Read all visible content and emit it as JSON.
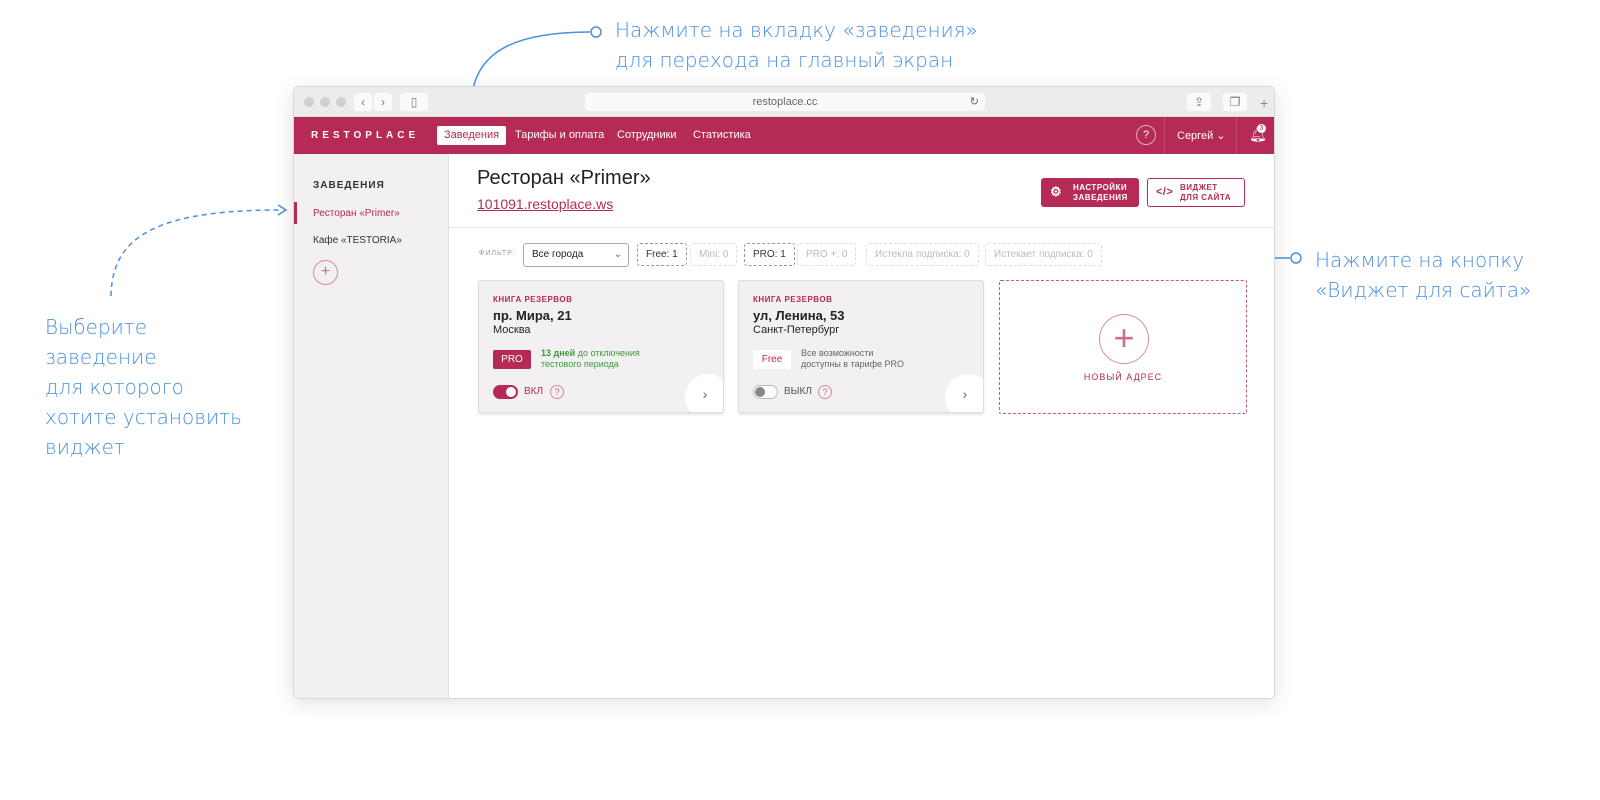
{
  "annotations": {
    "top": [
      "Нажмите на вкладку «заведения»",
      "для перехода на главный экран"
    ],
    "right": [
      "Нажмите на кнопку",
      "«Виджет для сайта»"
    ],
    "left": [
      "Выберите",
      "заведение",
      "для которого",
      "хотите установить",
      "виджет"
    ]
  },
  "browser": {
    "url": "restoplace.cc"
  },
  "nav": {
    "logo": "RESTOPLACE",
    "tabs": [
      "Заведения",
      "Тарифы и оплата",
      "Сотрудники",
      "Статистика"
    ],
    "help": "?",
    "user": "Сергей",
    "notifications": "3"
  },
  "sidebar": {
    "title": "ЗАВЕДЕНИЯ",
    "items": [
      "Ресторан «Primer»",
      "Кафе «TESTORIA»"
    ],
    "add": "+"
  },
  "header": {
    "title": "Ресторан «Primer»",
    "link": "101091.restoplace.ws",
    "settings_btn": [
      "НАСТРОЙКИ",
      "ЗАВЕДЕНИЯ"
    ],
    "widget_btn": [
      "ВИДЖЕТ",
      "ДЛЯ САЙТА"
    ]
  },
  "filter": {
    "label": "ФИЛЬТР:",
    "city": "Все города",
    "chips": [
      "Free: 1",
      "Mini: 0",
      "PRO: 1",
      "PRO +: 0",
      "Истекла подписка: 0",
      "Истекает подписка: 0"
    ]
  },
  "cards": [
    {
      "kicker": "КНИГА РЕЗЕРВОВ",
      "address": "пр. Мира, 21",
      "city": "Москва",
      "plan": "PRO",
      "note_bold": "13 дней",
      "note": " до отключения",
      "note2": "тестового периода",
      "toggle": "ВКЛ",
      "toggle_on": true
    },
    {
      "kicker": "КНИГА РЕЗЕРВОВ",
      "address": "ул, Ленина, 53",
      "city": "Санкт-Петербург",
      "plan": "Free",
      "note": "Все возможности",
      "note2": "доступны в тарифе PRO",
      "toggle": "ВЫКЛ",
      "toggle_on": false
    }
  ],
  "new_address": "НОВЫЙ АДРЕС",
  "colors": {
    "brand": "#b52b55",
    "annotation": "#4a90e2"
  }
}
